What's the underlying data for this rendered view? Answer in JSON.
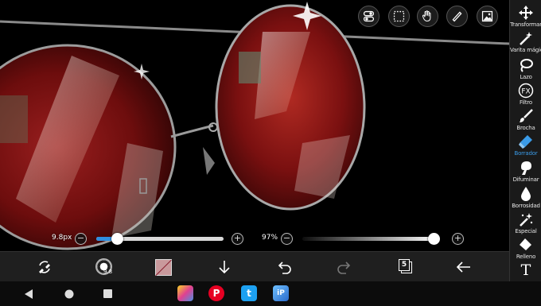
{
  "right_toolbar": {
    "tools": [
      {
        "label": "Transformar",
        "icon": "move-icon"
      },
      {
        "label": "Varita mágica",
        "icon": "magic-wand-icon"
      },
      {
        "label": "Lazo",
        "icon": "lasso-icon"
      },
      {
        "label": "Filtro",
        "icon": "fx-icon",
        "icon_text": "FX"
      },
      {
        "label": "Brocha",
        "icon": "brush-icon"
      },
      {
        "label": "Borrador",
        "icon": "eraser-icon",
        "active": true
      },
      {
        "label": "Difuminar",
        "icon": "smudge-icon"
      },
      {
        "label": "Borrosidad",
        "icon": "blur-drop-icon"
      },
      {
        "label": "Especial",
        "icon": "special-wand-icon"
      },
      {
        "label": "Relleno",
        "icon": "fill-bucket-icon"
      },
      {
        "label": "",
        "icon": "text-icon",
        "icon_text": "T"
      }
    ],
    "active_color": "#3a9be8"
  },
  "sliders": {
    "brush_size": {
      "label": "9.8px",
      "fraction": 0.16,
      "minus": "−",
      "plus": "+"
    },
    "opacity": {
      "label": "97%",
      "fraction": 0.97,
      "minus": "−",
      "plus": "+"
    }
  },
  "bottom_toolbar": {
    "brush_size_small": "9.8",
    "layers_count": "5",
    "color_hex": "#c9999c"
  },
  "top_tools": [
    "layers-toggle-icon",
    "selection-icon",
    "hand-icon",
    "ruler-icon",
    "image-icon"
  ],
  "nav_apps": [
    {
      "name": "ibis-paint-icon",
      "color": "#e04090"
    },
    {
      "name": "pinterest-icon",
      "color": "#e60023",
      "glyph": "P"
    },
    {
      "name": "twitter-icon",
      "color": "#1da1f2",
      "glyph": "t"
    },
    {
      "name": "ibis-x-icon",
      "color": "#2a6acb",
      "glyph": "iP"
    }
  ]
}
